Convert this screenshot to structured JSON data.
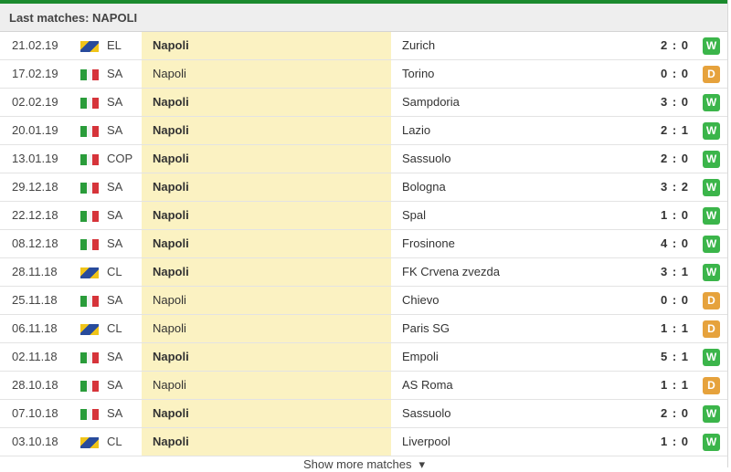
{
  "header": {
    "title": "Last matches: NAPOLI"
  },
  "colors": {
    "win": "#3bb54a",
    "draw": "#e6a23c",
    "highlight": "#fbf2c2",
    "topbar": "#1b8a2e"
  },
  "matches": [
    {
      "date": "21.02.19",
      "flag": "eu-flag-icon",
      "league": "EL",
      "home": "Napoli",
      "home_bold": true,
      "away": "Zurich",
      "score": "2 : 0",
      "result": "W"
    },
    {
      "date": "17.02.19",
      "flag": "italy-flag-icon",
      "league": "SA",
      "home": "Napoli",
      "home_bold": false,
      "away": "Torino",
      "score": "0 : 0",
      "result": "D"
    },
    {
      "date": "02.02.19",
      "flag": "italy-flag-icon",
      "league": "SA",
      "home": "Napoli",
      "home_bold": true,
      "away": "Sampdoria",
      "score": "3 : 0",
      "result": "W"
    },
    {
      "date": "20.01.19",
      "flag": "italy-flag-icon",
      "league": "SA",
      "home": "Napoli",
      "home_bold": true,
      "away": "Lazio",
      "score": "2 : 1",
      "result": "W"
    },
    {
      "date": "13.01.19",
      "flag": "italy-flag-icon",
      "league": "COP",
      "home": "Napoli",
      "home_bold": true,
      "away": "Sassuolo",
      "score": "2 : 0",
      "result": "W"
    },
    {
      "date": "29.12.18",
      "flag": "italy-flag-icon",
      "league": "SA",
      "home": "Napoli",
      "home_bold": true,
      "away": "Bologna",
      "score": "3 : 2",
      "result": "W"
    },
    {
      "date": "22.12.18",
      "flag": "italy-flag-icon",
      "league": "SA",
      "home": "Napoli",
      "home_bold": true,
      "away": "Spal",
      "score": "1 : 0",
      "result": "W"
    },
    {
      "date": "08.12.18",
      "flag": "italy-flag-icon",
      "league": "SA",
      "home": "Napoli",
      "home_bold": true,
      "away": "Frosinone",
      "score": "4 : 0",
      "result": "W"
    },
    {
      "date": "28.11.18",
      "flag": "eu-flag-icon",
      "league": "CL",
      "home": "Napoli",
      "home_bold": true,
      "away": "FK Crvena zvezda",
      "score": "3 : 1",
      "result": "W"
    },
    {
      "date": "25.11.18",
      "flag": "italy-flag-icon",
      "league": "SA",
      "home": "Napoli",
      "home_bold": false,
      "away": "Chievo",
      "score": "0 : 0",
      "result": "D"
    },
    {
      "date": "06.11.18",
      "flag": "eu-flag-icon",
      "league": "CL",
      "home": "Napoli",
      "home_bold": false,
      "away": "Paris SG",
      "score": "1 : 1",
      "result": "D"
    },
    {
      "date": "02.11.18",
      "flag": "italy-flag-icon",
      "league": "SA",
      "home": "Napoli",
      "home_bold": true,
      "away": "Empoli",
      "score": "5 : 1",
      "result": "W"
    },
    {
      "date": "28.10.18",
      "flag": "italy-flag-icon",
      "league": "SA",
      "home": "Napoli",
      "home_bold": false,
      "away": "AS Roma",
      "score": "1 : 1",
      "result": "D"
    },
    {
      "date": "07.10.18",
      "flag": "italy-flag-icon",
      "league": "SA",
      "home": "Napoli",
      "home_bold": true,
      "away": "Sassuolo",
      "score": "2 : 0",
      "result": "W"
    },
    {
      "date": "03.10.18",
      "flag": "eu-flag-icon",
      "league": "CL",
      "home": "Napoli",
      "home_bold": true,
      "away": "Liverpool",
      "score": "1 : 0",
      "result": "W"
    }
  ],
  "footer": {
    "show_more": "Show more matches",
    "arrow_icon": "chevron-down-icon"
  }
}
